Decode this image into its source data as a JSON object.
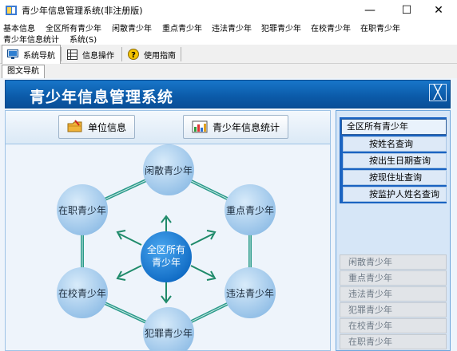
{
  "window": {
    "title": "青少年信息管理系统(非注册版)",
    "minimize": "—",
    "maximize": "☐",
    "close": "✕"
  },
  "menu": [
    "基本信息",
    "全区所有青少年",
    "闲散青少年",
    "重点青少年",
    "违法青少年",
    "犯罪青少年",
    "在校青少年",
    "在职青少年",
    "青少年信息统计",
    "系统(S)"
  ],
  "toolbar": {
    "nav": "系统导航",
    "ops": "信息操作",
    "guide": "使用指南"
  },
  "tab": "图文导航",
  "banner": {
    "title": "青少年信息管理系统",
    "close": "╳"
  },
  "buttons": {
    "unit": "单位信息",
    "stats": "青少年信息统计"
  },
  "diagram": {
    "center": [
      "全区所有",
      "青少年"
    ],
    "nodes": [
      "闲散青少年",
      "重点青少年",
      "违法青少年",
      "犯罪青少年",
      "在校青少年",
      "在职青少年"
    ]
  },
  "right_panel": {
    "header": "全区所有青少年",
    "items": [
      "按姓名查询",
      "按出生日期查询",
      "按现住址查询",
      "按监护人姓名查询"
    ],
    "categories": [
      "闲散青少年",
      "重点青少年",
      "违法青少年",
      "犯罪青少年",
      "在校青少年",
      "在职青少年"
    ]
  },
  "colors": {
    "banner": "#0b5aa8",
    "node": "#9cc6e8",
    "center": "#1a7fd6",
    "connector": "#2a9a8a"
  }
}
